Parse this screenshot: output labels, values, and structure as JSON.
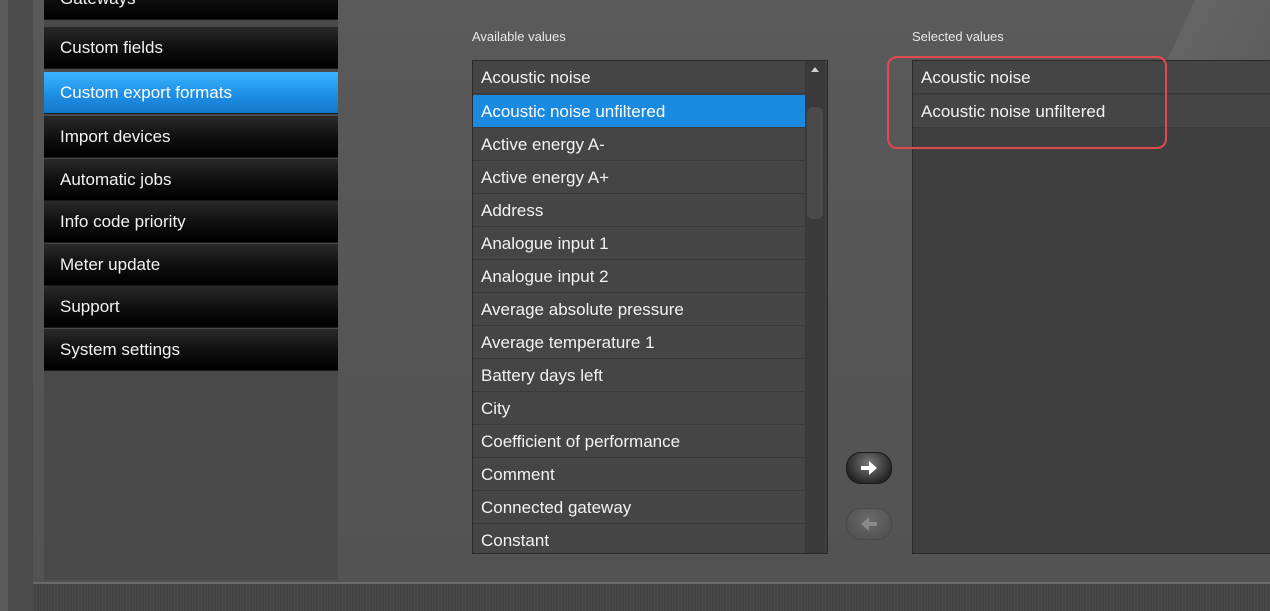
{
  "sidebar": {
    "items": [
      {
        "label": "Gateways"
      },
      {
        "label": "Custom fields"
      },
      {
        "label": "Custom export formats",
        "active": true
      },
      {
        "label": "Import devices"
      },
      {
        "label": "Automatic jobs"
      },
      {
        "label": "Info code priority"
      },
      {
        "label": "Meter update"
      },
      {
        "label": "Support"
      },
      {
        "label": "System settings"
      }
    ]
  },
  "available": {
    "label": "Available values",
    "items": [
      "Acoustic noise",
      "Acoustic noise unfiltered",
      "Active energy A-",
      "Active energy A+",
      "Address",
      "Analogue input 1",
      "Analogue input 2",
      "Average absolute pressure",
      "Average temperature 1",
      "Battery days left",
      "City",
      "Coefficient of performance",
      "Comment",
      "Connected gateway",
      "Constant"
    ],
    "selected_index": 1
  },
  "selected": {
    "label": "Selected values",
    "items": [
      "Acoustic noise",
      "Acoustic noise unfiltered"
    ]
  },
  "buttons": {
    "add_icon": "arrow-right-icon",
    "remove_icon": "arrow-left-icon"
  },
  "colors": {
    "accent": "#1a8ae0",
    "highlight": "#e2484c"
  }
}
